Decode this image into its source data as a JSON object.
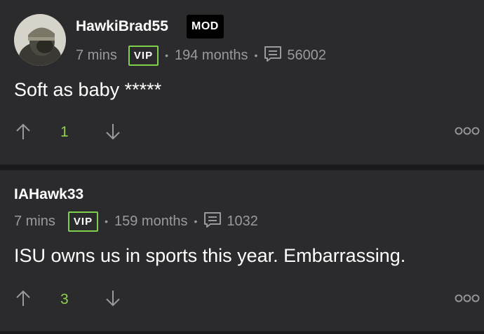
{
  "posts": [
    {
      "username": "HawkiBrad55",
      "badge": "MOD",
      "time": "7 mins",
      "vip": "VIP",
      "tenure": "194 months",
      "post_count": "56002",
      "body": "Soft as baby *****",
      "votes": "1",
      "avatar_icon": "user-avatar-icon"
    },
    {
      "username": "IAHawk33",
      "time": "7 mins",
      "vip": "VIP",
      "tenure": "159 months",
      "post_count": "1032",
      "body": "ISU owns us in sports this year. Embarrassing.",
      "votes": "3"
    }
  ],
  "icons": {
    "upvote": "arrow-up-icon",
    "downvote": "arrow-down-icon",
    "more": "more-options-icon",
    "comments": "comment-icon",
    "separator": "•"
  },
  "colors": {
    "background": "#2b2a2d",
    "divider": "#1a191b",
    "vip_border": "#7fd14d",
    "vote_count": "#8fd14f",
    "meta_text": "#9a9a9e"
  }
}
